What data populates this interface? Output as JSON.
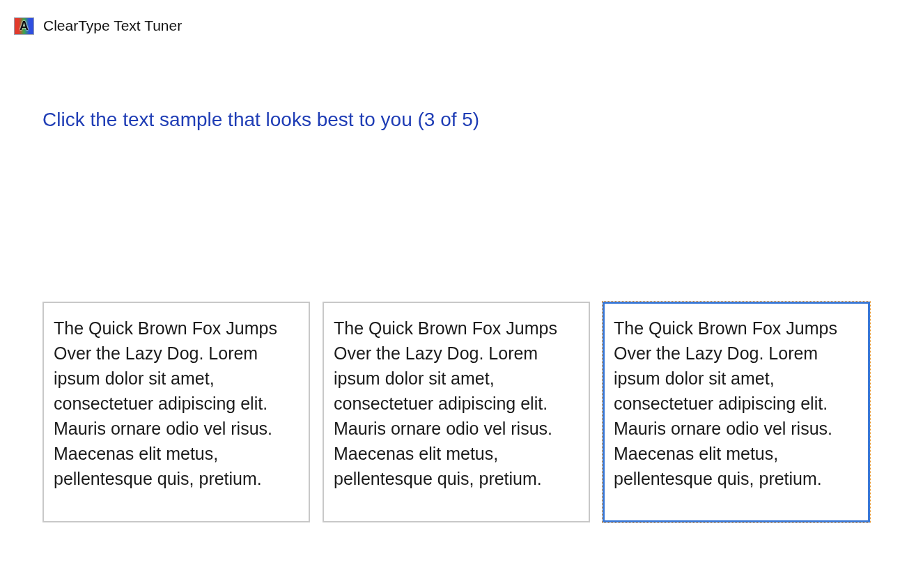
{
  "window": {
    "title": "ClearType Text Tuner",
    "logo_letter": "A"
  },
  "heading": "Click the text sample that looks best to you (3 of 5)",
  "samples": [
    {
      "text": "The Quick Brown Fox Jumps Over the Lazy Dog. Lorem ipsum dolor sit amet, consectetuer adipiscing elit. Mauris ornare odio vel risus. Maecenas elit metus, pellentesque quis, pretium.",
      "selected": false
    },
    {
      "text": "The Quick Brown Fox Jumps Over the Lazy Dog. Lorem ipsum dolor sit amet, consectetuer adipiscing elit. Mauris ornare odio vel risus. Maecenas elit metus, pellentesque quis, pretium.",
      "selected": false
    },
    {
      "text": "The Quick Brown Fox Jumps Over the Lazy Dog. Lorem ipsum dolor sit amet, consectetuer adipiscing elit. Mauris ornare odio vel risus. Maecenas elit metus, pellentesque quis, pretium.",
      "selected": true
    }
  ]
}
